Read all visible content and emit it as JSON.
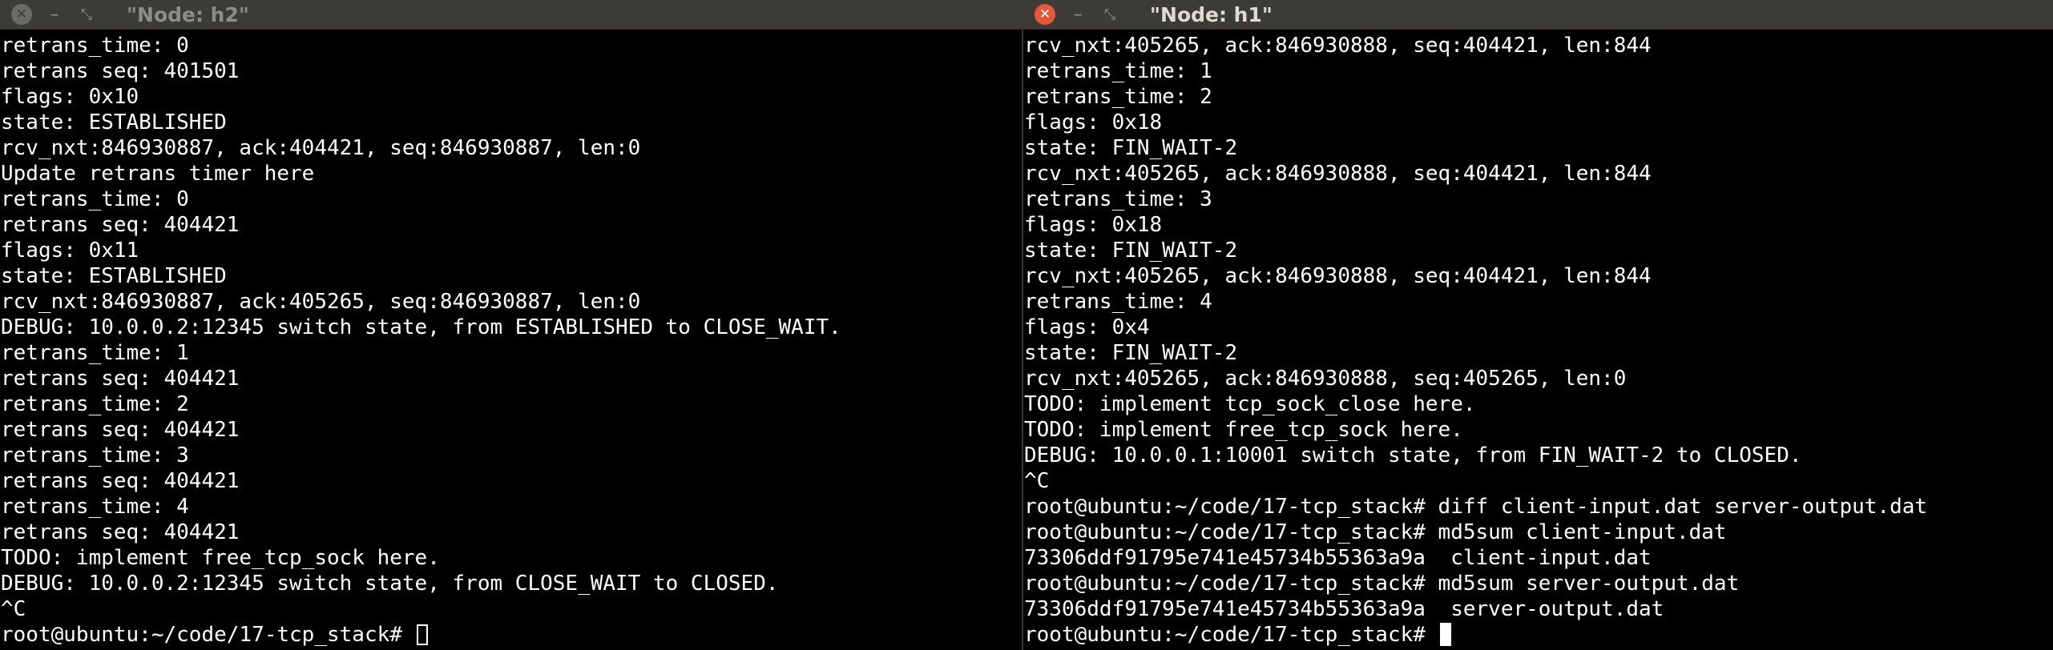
{
  "windows": {
    "left": {
      "title": "\"Node: h2\"",
      "close_glyph": "✕",
      "minimize_glyph": "–",
      "maximize_glyph": "⤡",
      "lines": [
        "retrans_time: 0",
        "retrans seq: 401501",
        "flags: 0x10",
        "state: ESTABLISHED",
        "rcv_nxt:846930887, ack:404421, seq:846930887, len:0",
        "Update retrans timer here",
        "retrans_time: 0",
        "retrans seq: 404421",
        "flags: 0x11",
        "state: ESTABLISHED",
        "rcv_nxt:846930887, ack:405265, seq:846930887, len:0",
        "DEBUG: 10.0.0.2:12345 switch state, from ESTABLISHED to CLOSE_WAIT.",
        "retrans_time: 1",
        "retrans seq: 404421",
        "retrans_time: 2",
        "retrans seq: 404421",
        "retrans_time: 3",
        "retrans seq: 404421",
        "retrans_time: 4",
        "retrans seq: 404421",
        "TODO: implement free_tcp_sock here.",
        "DEBUG: 10.0.0.2:12345 switch state, from CLOSE_WAIT to CLOSED.",
        "^C"
      ],
      "prompt": "root@ubuntu:~/code/17-tcp_stack# "
    },
    "right": {
      "title": "\"Node: h1\"",
      "close_glyph": "✕",
      "minimize_glyph": "–",
      "maximize_glyph": "⤡",
      "lines": [
        "rcv_nxt:405265, ack:846930888, seq:404421, len:844",
        "retrans_time: 1",
        "retrans_time: 2",
        "flags: 0x18",
        "state: FIN_WAIT-2",
        "rcv_nxt:405265, ack:846930888, seq:404421, len:844",
        "retrans_time: 3",
        "flags: 0x18",
        "state: FIN_WAIT-2",
        "rcv_nxt:405265, ack:846930888, seq:404421, len:844",
        "retrans_time: 4",
        "flags: 0x4",
        "state: FIN_WAIT-2",
        "rcv_nxt:405265, ack:846930888, seq:405265, len:0",
        "TODO: implement tcp_sock_close here.",
        "TODO: implement free_tcp_sock here.",
        "DEBUG: 10.0.0.1:10001 switch state, from FIN_WAIT-2 to CLOSED.",
        "^C",
        "root@ubuntu:~/code/17-tcp_stack# diff client-input.dat server-output.dat",
        "root@ubuntu:~/code/17-tcp_stack# md5sum client-input.dat",
        "73306ddf91795e741e45734b55363a9a  client-input.dat",
        "root@ubuntu:~/code/17-tcp_stack# md5sum server-output.dat",
        "73306ddf91795e741e45734b55363a9a  server-output.dat"
      ],
      "prompt": "root@ubuntu:~/code/17-tcp_stack# "
    }
  },
  "colors": {
    "titlebar_bg": "#3c3b37",
    "terminal_bg": "#000000",
    "terminal_fg": "#ffffff",
    "close_active": "#e5573a"
  }
}
